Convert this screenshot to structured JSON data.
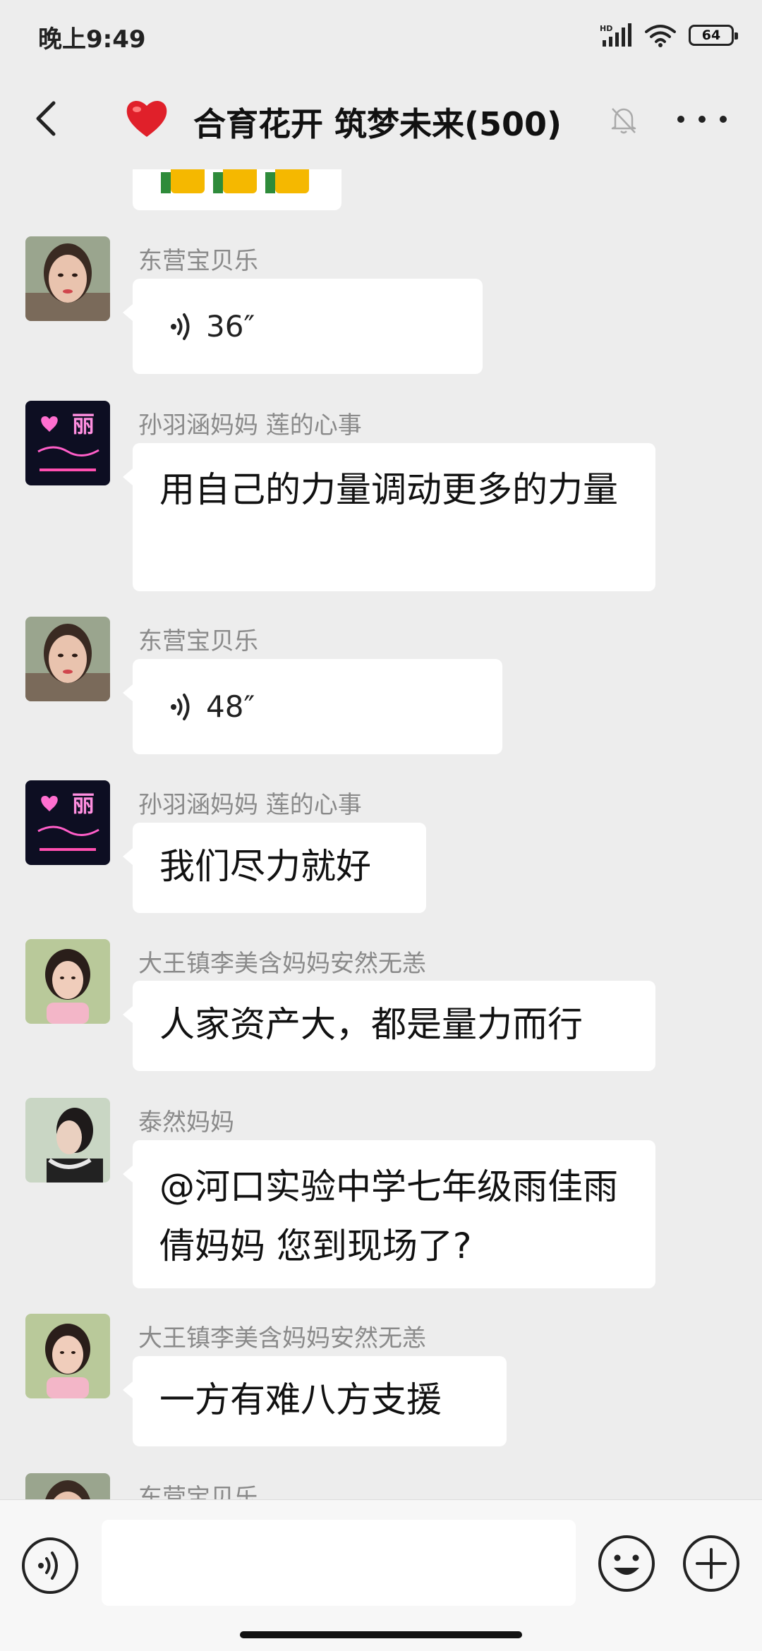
{
  "status_bar": {
    "time": "晚上9:49",
    "battery": "64",
    "network": "HD"
  },
  "header": {
    "title": "合育花开 筑梦未来(500)"
  },
  "messages": [
    {
      "sender": "东营宝贝乐",
      "type": "voice",
      "duration": "36″"
    },
    {
      "sender": "孙羽涵妈妈  莲的心事",
      "type": "text",
      "text": "用自己的力量调动更多的力量"
    },
    {
      "sender": "东营宝贝乐",
      "type": "voice",
      "duration": "48″"
    },
    {
      "sender": "孙羽涵妈妈  莲的心事",
      "type": "text",
      "text": "我们尽力就好"
    },
    {
      "sender": "大王镇李美含妈妈安然无恙",
      "type": "text",
      "text": "人家资产大，都是量力而行"
    },
    {
      "sender": "泰然妈妈",
      "type": "text",
      "text": "@河口实验中学七年级雨佳雨倩妈妈  您到现场了?"
    },
    {
      "sender": "大王镇李美含妈妈安然无恙",
      "type": "text",
      "text": "一方有难八方支援"
    },
    {
      "sender": "东营宝贝乐",
      "type": "partial"
    }
  ],
  "avatar_labels": {
    "lian": "丽"
  },
  "input": {
    "placeholder": ""
  },
  "colors": {
    "background": "#ededed",
    "bubble": "#ffffff",
    "sender": "#8a8a8a",
    "thumb": "#f5b800"
  }
}
